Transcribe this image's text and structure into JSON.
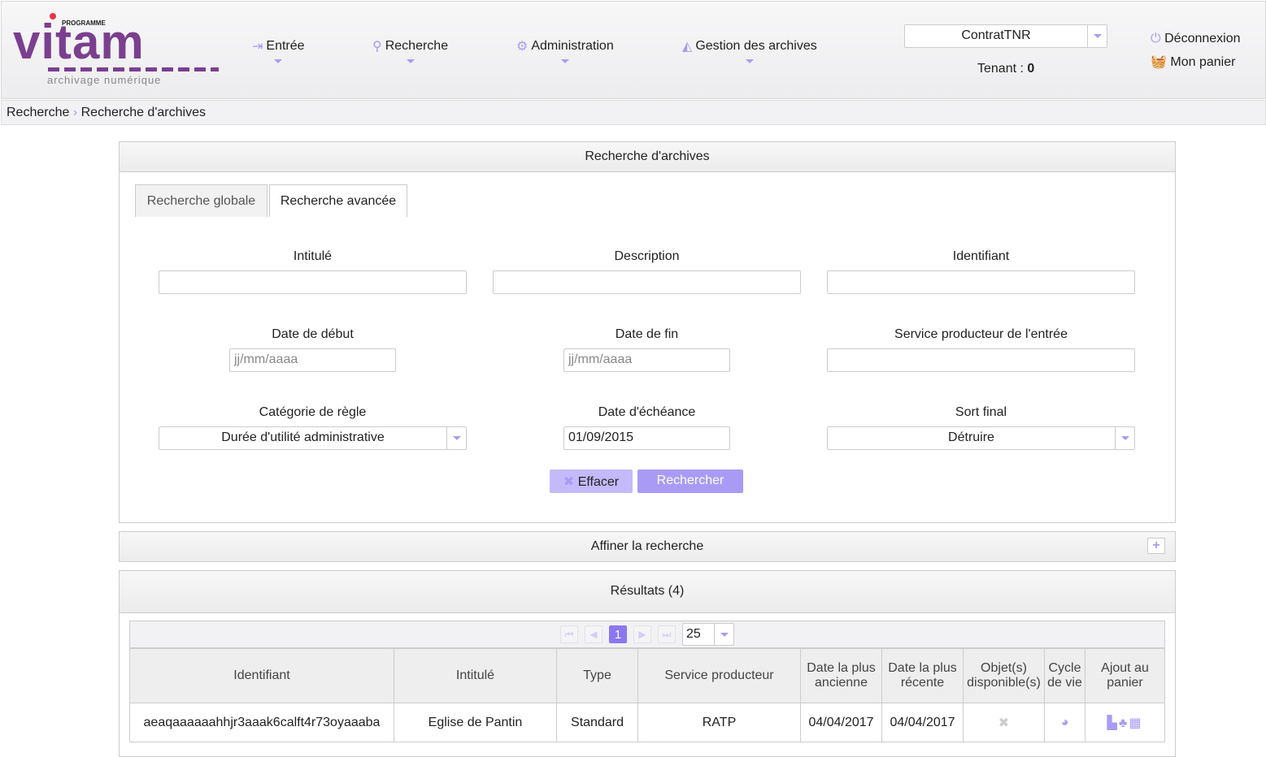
{
  "header": {
    "logo_top": "PROGRAMME",
    "logo_word": "vitam",
    "logo_sub": "archivage numérique",
    "nav": [
      {
        "label": "Entrée",
        "icon": "sign-in-icon"
      },
      {
        "label": "Recherche",
        "icon": "search-icon"
      },
      {
        "label": "Administration",
        "icon": "gears-icon"
      },
      {
        "label": "Gestion des archives",
        "icon": "area-chart-icon"
      }
    ],
    "contract": "ContratTNR",
    "tenant_label": "Tenant : ",
    "tenant_value": "0",
    "logout": "Déconnexion",
    "basket": "Mon panier"
  },
  "breadcrumb": [
    "Recherche",
    "Recherche d'archives"
  ],
  "search": {
    "title": "Recherche d'archives",
    "tabs": [
      "Recherche globale",
      "Recherche avancée"
    ],
    "active_tab": 1,
    "fields": {
      "intitule": "Intitulé",
      "description": "Description",
      "identifiant": "Identifiant",
      "date_debut": "Date de début",
      "date_fin": "Date de fin",
      "service": "Service producteur de l'entrée",
      "categorie": "Catégorie de règle",
      "echeance": "Date d'échéance",
      "sort": "Sort final"
    },
    "date_placeholder": "jj/mm/aaaa",
    "categorie_value": "Durée d'utilité administrative",
    "echeance_value": "01/09/2015",
    "sort_value": "Détruire",
    "clear": "Effacer",
    "submit": "Rechercher"
  },
  "refine": {
    "title": "Affiner la recherche"
  },
  "results": {
    "title": "Résultats (4)",
    "page": "1",
    "page_size": "25",
    "columns": [
      "Identifiant",
      "Intitulé",
      "Type",
      "Service producteur",
      "Date la plus ancienne",
      "Date la plus récente",
      "Objet(s) disponible(s)",
      "Cycle de vie",
      "Ajout au panier"
    ],
    "rows": [
      {
        "id": "aeaqaaaaaahhjr3aaak6calft4r73oyaaaba",
        "title": "Eglise de Pantin",
        "type": "Standard",
        "producer": "RATP",
        "oldest": "04/04/2017",
        "newest": "04/04/2017"
      }
    ]
  },
  "colors": {
    "accent": "#a99bf5",
    "active": "#8b77f0"
  }
}
